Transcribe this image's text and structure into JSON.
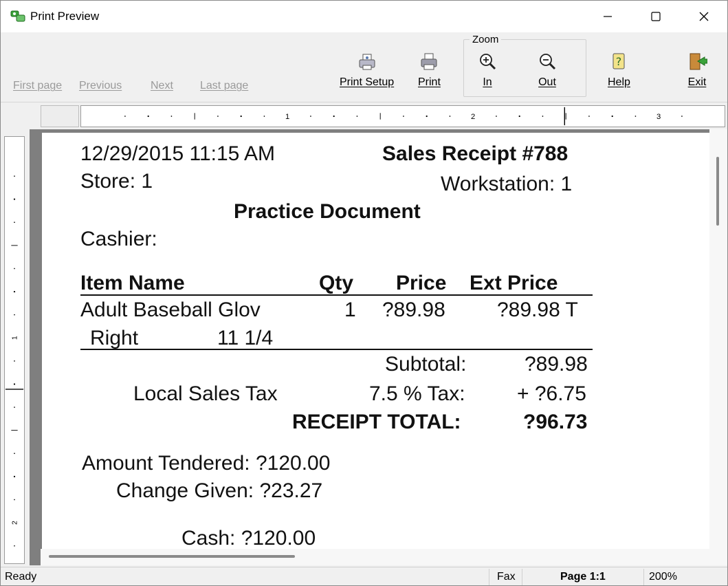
{
  "window": {
    "title": "Print Preview"
  },
  "toolbar": {
    "first_page": "First page",
    "previous": "Previous",
    "next": "Next",
    "last_page": "Last page",
    "print_setup": "Print Setup",
    "print": "Print",
    "zoom_group": "Zoom",
    "zoom_in": "In",
    "zoom_out": "Out",
    "help": "Help",
    "exit": "Exit"
  },
  "ruler": {
    "labels": [
      "1",
      "2",
      "3"
    ],
    "v_labels": [
      "1",
      "2"
    ]
  },
  "receipt": {
    "datetime": "12/29/2015 11:15 AM",
    "title": "Sales Receipt  #788",
    "store": "Store:  1",
    "workstation": "Workstation:  1",
    "doc_type": "Practice Document",
    "cashier": "Cashier:",
    "headers": {
      "item": "Item Name",
      "qty": "Qty",
      "price": "Price",
      "ext": "Ext Price"
    },
    "item": {
      "name": "Adult Baseball Glov",
      "qty": "1",
      "price": "?89.98",
      "ext": "?89.98 T",
      "attr1": "Right",
      "attr2": "11 1/4"
    },
    "subtotal_label": "Subtotal:",
    "subtotal_value": "?89.98",
    "tax_name": "Local Sales Tax",
    "tax_label": "7.5 % Tax:",
    "tax_value": "+ ?6.75",
    "total_label": "RECEIPT TOTAL:",
    "total_value": "?96.73",
    "tendered": "Amount Tendered:  ?120.00",
    "change": "Change Given:  ?23.27",
    "cash": "Cash: ?120.00"
  },
  "status": {
    "left": "Ready",
    "fax": "Fax",
    "page": "Page 1:1",
    "zoom": "200%"
  }
}
